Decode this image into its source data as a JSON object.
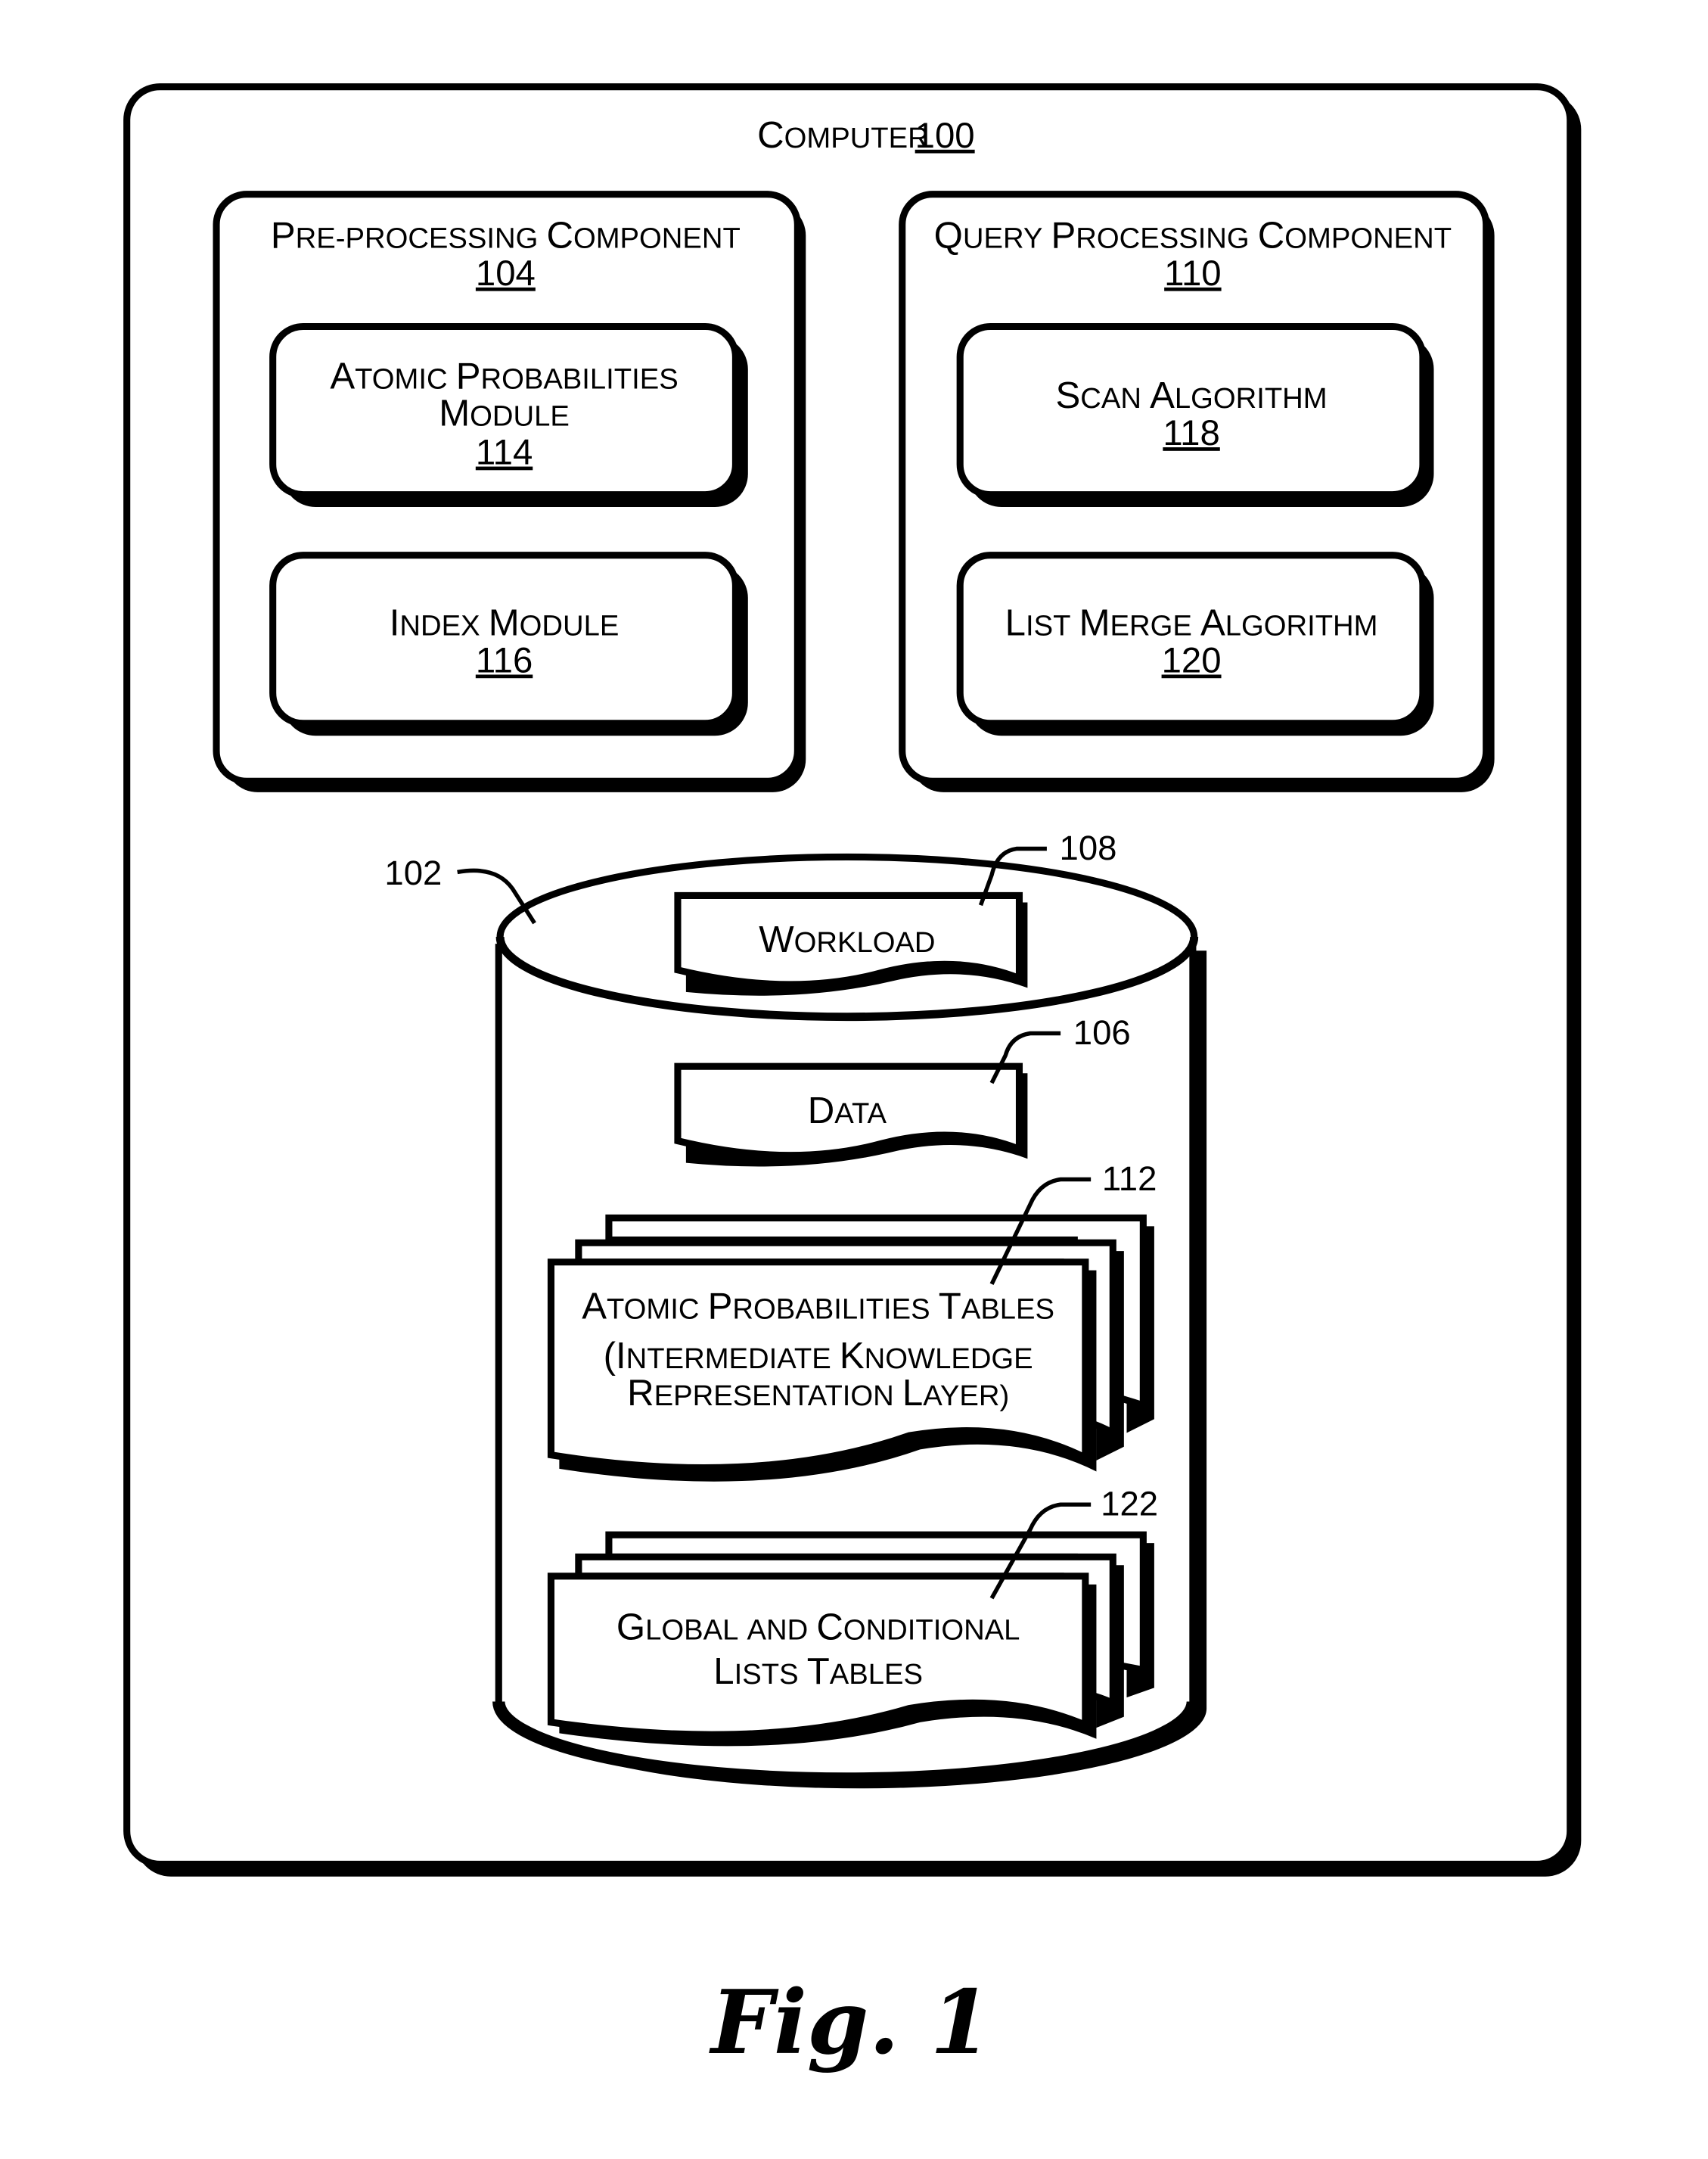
{
  "figure": {
    "caption": "Fig. 1",
    "computer": {
      "label": "Computer",
      "ref": "100"
    },
    "pre_processing": {
      "label": "Pre-Processing Component",
      "ref": "104",
      "modules": [
        {
          "label_lines": [
            "Atomic Probabilities",
            "Module"
          ],
          "ref": "114"
        },
        {
          "label_lines": [
            "Index Module"
          ],
          "ref": "116"
        }
      ]
    },
    "query_processing": {
      "label": "Query Processing Component",
      "ref": "110",
      "modules": [
        {
          "label_lines": [
            "Scan Algorithm"
          ],
          "ref": "118"
        },
        {
          "label_lines": [
            "List Merge Algorithm"
          ],
          "ref": "120"
        }
      ]
    },
    "data_store": {
      "ref": "102",
      "documents": [
        {
          "label_lines": [
            "Workload"
          ],
          "ref": "108"
        },
        {
          "label_lines": [
            "Data"
          ],
          "ref": "106"
        },
        {
          "label_lines": [
            "Atomic Probabilities Tables",
            "(Intermediate Knowledge",
            "Representation Layer)"
          ],
          "ref": "112"
        },
        {
          "label_lines": [
            "Global and Conditional",
            "Lists Tables"
          ],
          "ref": "122"
        }
      ]
    }
  }
}
